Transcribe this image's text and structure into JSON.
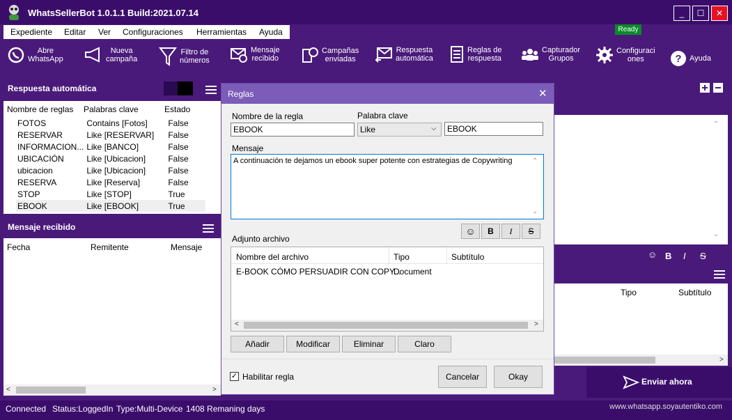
{
  "window": {
    "title": "WhatsSellerBot  1.0.1.1 Build:2021.07.14",
    "min": "_",
    "max": "☐",
    "close": "✕"
  },
  "menu": [
    "Expediente",
    "Editar",
    "Ver",
    "Configuraciones",
    "Herramientas",
    "Ayuda"
  ],
  "ready_badge": "Ready",
  "toolbar": [
    {
      "l1": "Abre",
      "l2": "WhatsApp",
      "icon": "whatsapp-icon"
    },
    {
      "l1": "Nueva",
      "l2": "campaña",
      "icon": "megaphone-icon"
    },
    {
      "l1": "Filtro de",
      "l2": "números",
      "icon": "filter-icon"
    },
    {
      "l1": "Mensaje",
      "l2": "recibido",
      "icon": "envelope-check-icon"
    },
    {
      "l1": "Campañas",
      "l2": "enviadas",
      "icon": "campaigns-icon"
    },
    {
      "l1": "Respuesta",
      "l2": "automática",
      "icon": "reply-icon"
    },
    {
      "l1": "Reglas de",
      "l2": "respuesta",
      "icon": "rules-icon"
    },
    {
      "l1": "Capturador",
      "l2": "Grupos",
      "icon": "group-icon"
    },
    {
      "l1": "Configuraci",
      "l2": "ones",
      "icon": "gear-icon"
    },
    {
      "l1": "Ayuda",
      "l2": "",
      "icon": "help-icon"
    }
  ],
  "auto_reply": {
    "title": "Respuesta automática",
    "cols": [
      "Nombre de reglas",
      "Palabras clave",
      "Estado"
    ],
    "rows": [
      [
        "FOTOS",
        "Contains [Fotos]",
        "False"
      ],
      [
        "RESERVAR",
        "Like [RESERVAR]",
        "False"
      ],
      [
        "INFORMACION...",
        "Like [BANCO]",
        "False"
      ],
      [
        "UBICACIÓN",
        "Like [Ubicacion]",
        "False"
      ],
      [
        "ubicacion",
        "Like [Ubicacion]",
        "False"
      ],
      [
        "RESERVA",
        "Like [Reserva]",
        "False"
      ],
      [
        "STOP",
        "Like [STOP]",
        "True"
      ],
      [
        "EBOOK",
        "Like [EBOOK]",
        "True"
      ]
    ]
  },
  "received": {
    "title": "Mensaje recibido",
    "cols": [
      "Fecha",
      "Remitente",
      "Mensaje"
    ]
  },
  "right_attach_cols": [
    "Tipo",
    "Subtítulo"
  ],
  "send_now": "Enviar ahora",
  "right_format": {
    "emoji": "☺",
    "bold": "B",
    "italic": "I",
    "strike": "S"
  },
  "dialog": {
    "title": "Reglas",
    "rule_name_label": "Nombre de la regla",
    "rule_name": "EBOOK",
    "keyword_label": "Palabra clave",
    "match_type": "Like",
    "keyword": "EBOOK",
    "message_label": "Mensaje",
    "message": "A continuación te dejamos un ebook super potente con estrategias de Copywriting",
    "attach_label": "Adjunto archivo",
    "format": {
      "emoji": "☺",
      "bold": "B",
      "italic": "I",
      "strike": "S"
    },
    "attach_cols": [
      "Nombre del archivo",
      "Tipo",
      "Subtítulo"
    ],
    "attach_rows": [
      [
        "E-BOOK CÓMO PERSUADIR CON COPY...",
        "Document",
        ""
      ]
    ],
    "buttons": {
      "add": "Añadir",
      "modify": "Modificar",
      "delete": "Eliminar",
      "clear": "Claro"
    },
    "enable_label": "Habilitar regla",
    "cancel": "Cancelar",
    "ok": "Okay"
  },
  "status": {
    "connected": "Connected",
    "login": "Status:LoggedIn",
    "type": "Type:Multi-Device",
    "days": "1408 Remaning days",
    "website": "www.whatsapp.soyautentiko.com"
  }
}
